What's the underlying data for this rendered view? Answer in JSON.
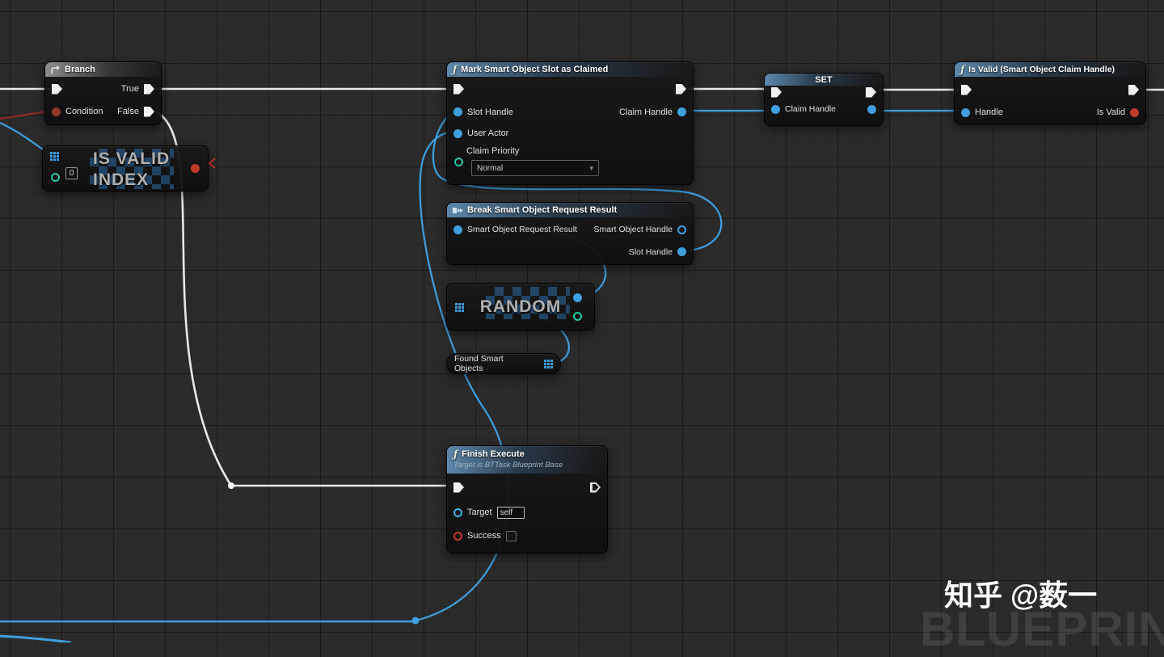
{
  "colors": {
    "exec_wire": "#e8e8e8",
    "data_wire": "#3f9fdf",
    "bool_pin": "#c0392b",
    "object_pin": "#3f9fdf",
    "enum_pin": "#1fc8a5",
    "background": "#2b2b2b"
  },
  "nodes": {
    "branch": {
      "title": "Branch",
      "pins": {
        "condition": "Condition",
        "true": "True",
        "false": "False"
      }
    },
    "is_valid_index": {
      "title_line1": "IS VALID",
      "title_line2": "INDEX",
      "index_default": "0"
    },
    "mark_smart_object": {
      "title": "Mark Smart Object Slot as Claimed",
      "pins": {
        "slot_handle": "Slot Handle",
        "user_actor": "User Actor",
        "claim_priority": "Claim Priority",
        "claim_handle": "Claim Handle"
      },
      "claim_priority_value": "Normal"
    },
    "set": {
      "title": "SET",
      "pins": {
        "claim_handle": "Claim Handle"
      }
    },
    "is_valid_claim": {
      "title": "Is Valid (Smart Object Claim Handle)",
      "pins": {
        "handle": "Handle",
        "is_valid": "Is Valid"
      }
    },
    "break_request": {
      "title": "Break Smart Object Request Result",
      "pins": {
        "input": "Smart Object Request Result",
        "smart_object_handle": "Smart Object Handle",
        "slot_handle": "Slot Handle"
      }
    },
    "random": {
      "title": "RANDOM"
    },
    "found_smart_objects": {
      "title": "Found Smart Objects"
    },
    "finish_execute": {
      "title": "Finish Execute",
      "subtitle": "Target is BTTask Blueprint Base",
      "pins": {
        "target": "Target",
        "success": "Success"
      },
      "target_value": "self"
    }
  },
  "watermark": {
    "text": "知乎 @薮一",
    "brand": "BLUEPRINT"
  }
}
